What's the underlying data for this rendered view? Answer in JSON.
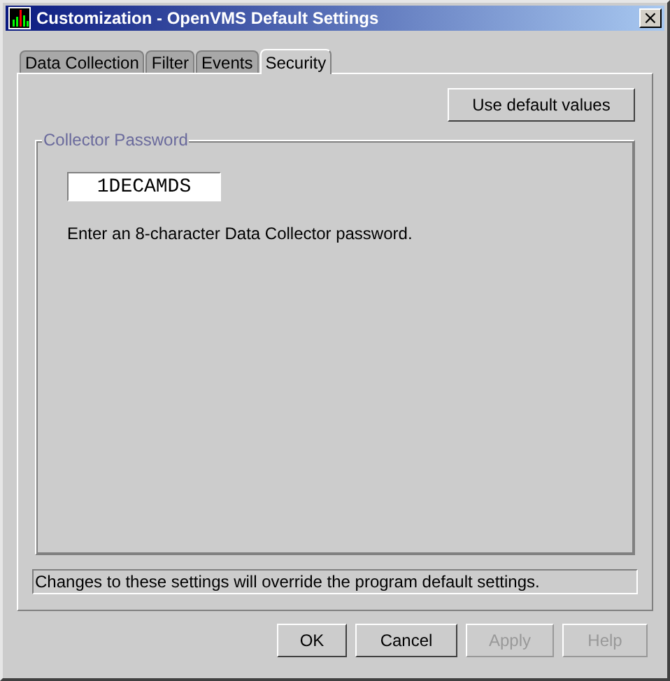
{
  "window": {
    "title": "Customization - OpenVMS Default Settings",
    "close": "×"
  },
  "tabs": [
    {
      "label": "Data Collection",
      "selected": false
    },
    {
      "label": "Filter",
      "selected": false
    },
    {
      "label": "Events",
      "selected": false
    },
    {
      "label": "Security",
      "selected": true
    }
  ],
  "default_button": {
    "label": "Use default values"
  },
  "group": {
    "title": "Collector Password",
    "value": "1DECAMDS",
    "hint": "Enter an 8-character Data Collector password."
  },
  "status": "Changes to these settings will override the program default settings.",
  "buttons": [
    {
      "label": "OK",
      "disabled": false
    },
    {
      "label": "Cancel",
      "disabled": false
    },
    {
      "label": "Apply",
      "disabled": true
    },
    {
      "label": "Help",
      "disabled": true
    }
  ]
}
